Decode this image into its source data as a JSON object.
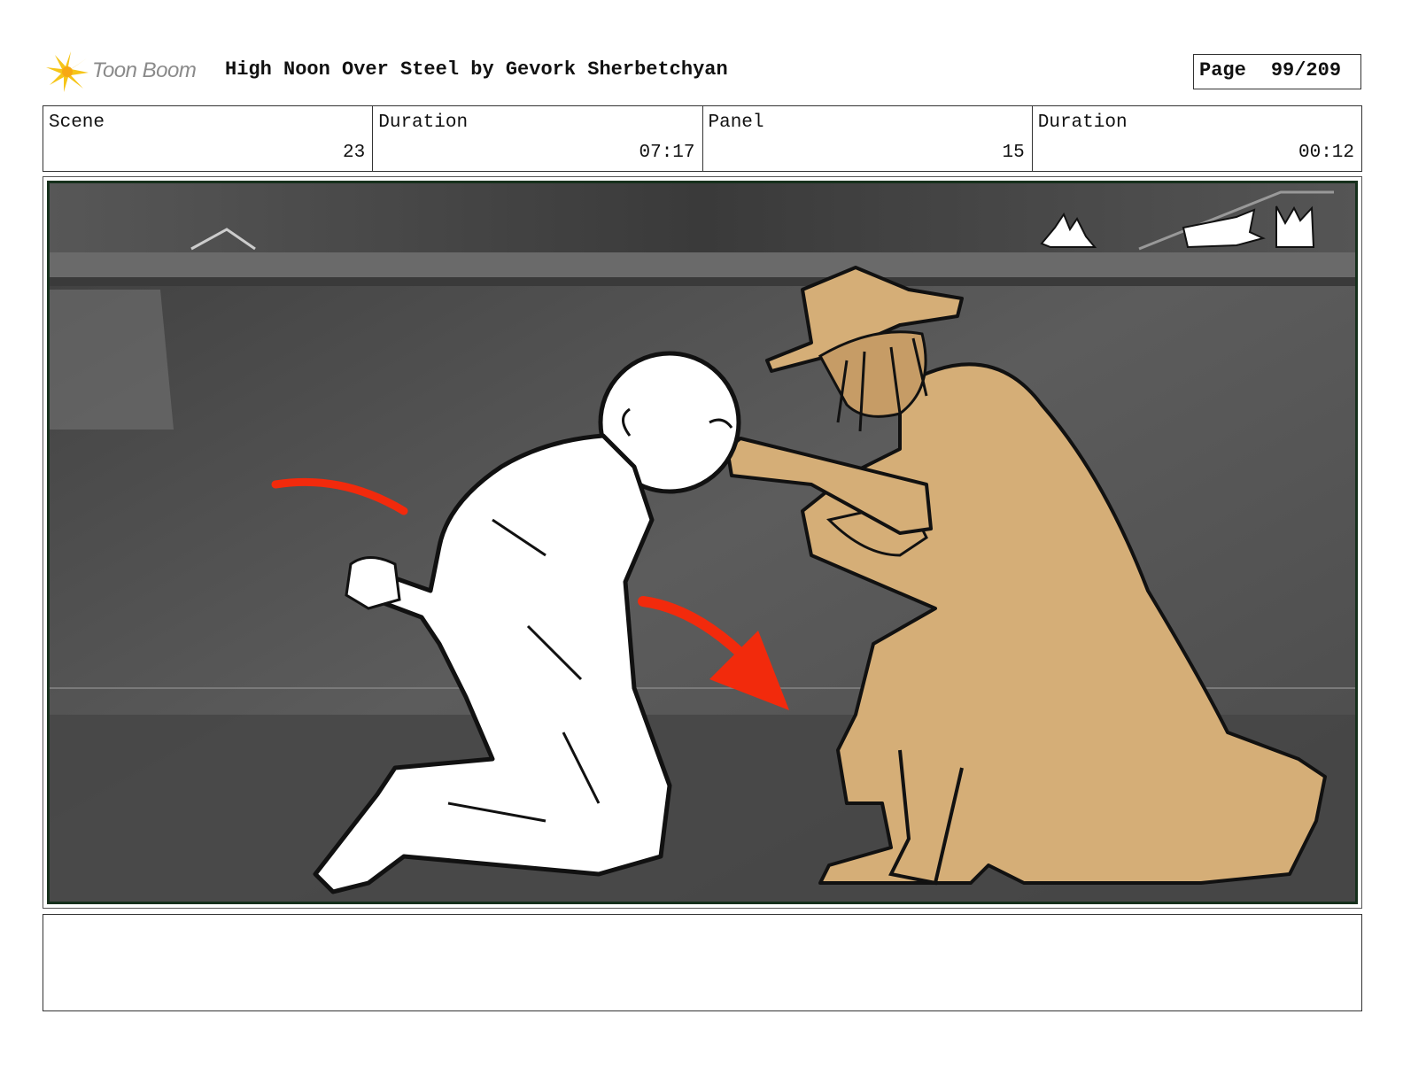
{
  "header": {
    "logo_text": "Toon Boom",
    "title": "High Noon Over Steel by Gevork Sherbetchyan",
    "page_label": "Page",
    "page_number": "99/209"
  },
  "info": {
    "scene_label": "Scene",
    "scene_value": "23",
    "scene_duration_label": "Duration",
    "scene_duration_value": "07:17",
    "panel_label": "Panel",
    "panel_value": "15",
    "panel_duration_label": "Duration",
    "panel_duration_value": "00:12"
  },
  "panel_image": {
    "icon": "storyboard-drawing",
    "colors": {
      "background": "#5a5a5a",
      "gunman": "#d5ae77",
      "arrows": "#f22a0c",
      "victim": "#ffffff"
    }
  },
  "notes": {
    "text": ""
  }
}
